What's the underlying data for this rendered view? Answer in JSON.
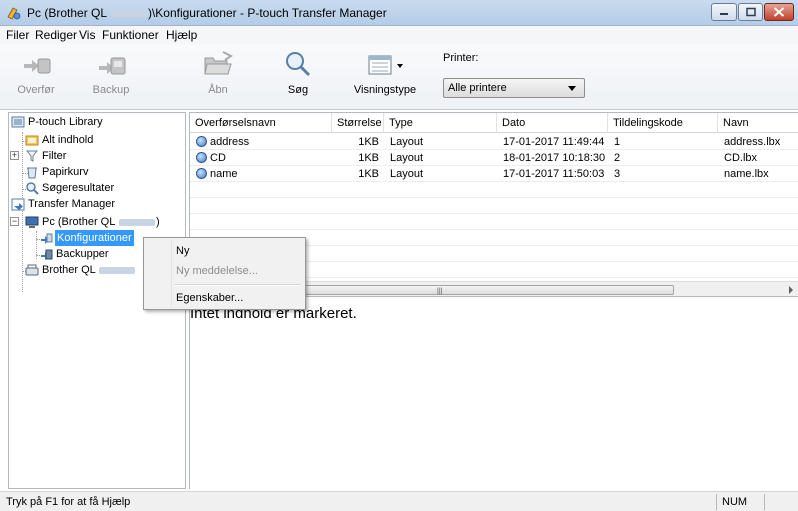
{
  "window": {
    "title": "Pc (Brother QL ████)\\Konfigurationer - P-touch Transfer Manager",
    "title_prefix": "Pc (Brother QL",
    "title_suffix": ")\\Konfigurationer - P-touch Transfer Manager"
  },
  "menu": [
    "Filer",
    "Rediger",
    "Vis",
    "Funktioner",
    "Hjælp"
  ],
  "toolbar": {
    "transfer": "Overfør",
    "backup": "Backup",
    "open": "Åbn",
    "search": "Søg",
    "view_type": "Visningstype",
    "printer_label": "Printer:",
    "printer_value": "Alle printere"
  },
  "tree": {
    "library": "P-touch Library",
    "all_content": "Alt indhold",
    "filter": "Filter",
    "recycle": "Papirkurv",
    "search_results": "Søgeresultater",
    "transfer_manager": "Transfer Manager",
    "pc_prefix": "Pc (Brother QL",
    "pc_suffix": ")",
    "configurations": "Konfigurationer",
    "backups": "Backupper",
    "brother": "Brother QL"
  },
  "table": {
    "columns": [
      "Overførselsnavn",
      "Størrelse",
      "Type",
      "Dato",
      "Tildelingskode",
      "Navn"
    ],
    "rows": [
      {
        "name": "address",
        "size": "1KB",
        "type": "Layout",
        "date": "17-01-2017 11:49:44",
        "code": "1",
        "file": "address.lbx"
      },
      {
        "name": "CD",
        "size": "1KB",
        "type": "Layout",
        "date": "18-01-2017 10:18:30",
        "code": "2",
        "file": "CD.lbx"
      },
      {
        "name": "name",
        "size": "1KB",
        "type": "Layout",
        "date": "17-01-2017 11:50:03",
        "code": "3",
        "file": "name.lbx"
      }
    ]
  },
  "preview": {
    "text": "Intet indhold er markeret."
  },
  "context_menu": {
    "new": "Ny",
    "new_message": "Ny meddelelse...",
    "properties": "Egenskaber..."
  },
  "status": {
    "help": "Tryk på F1 for at få Hjælp",
    "num": "NUM"
  },
  "colors": {
    "selection": "#3399ff",
    "titlebar": "#c9dbef"
  }
}
